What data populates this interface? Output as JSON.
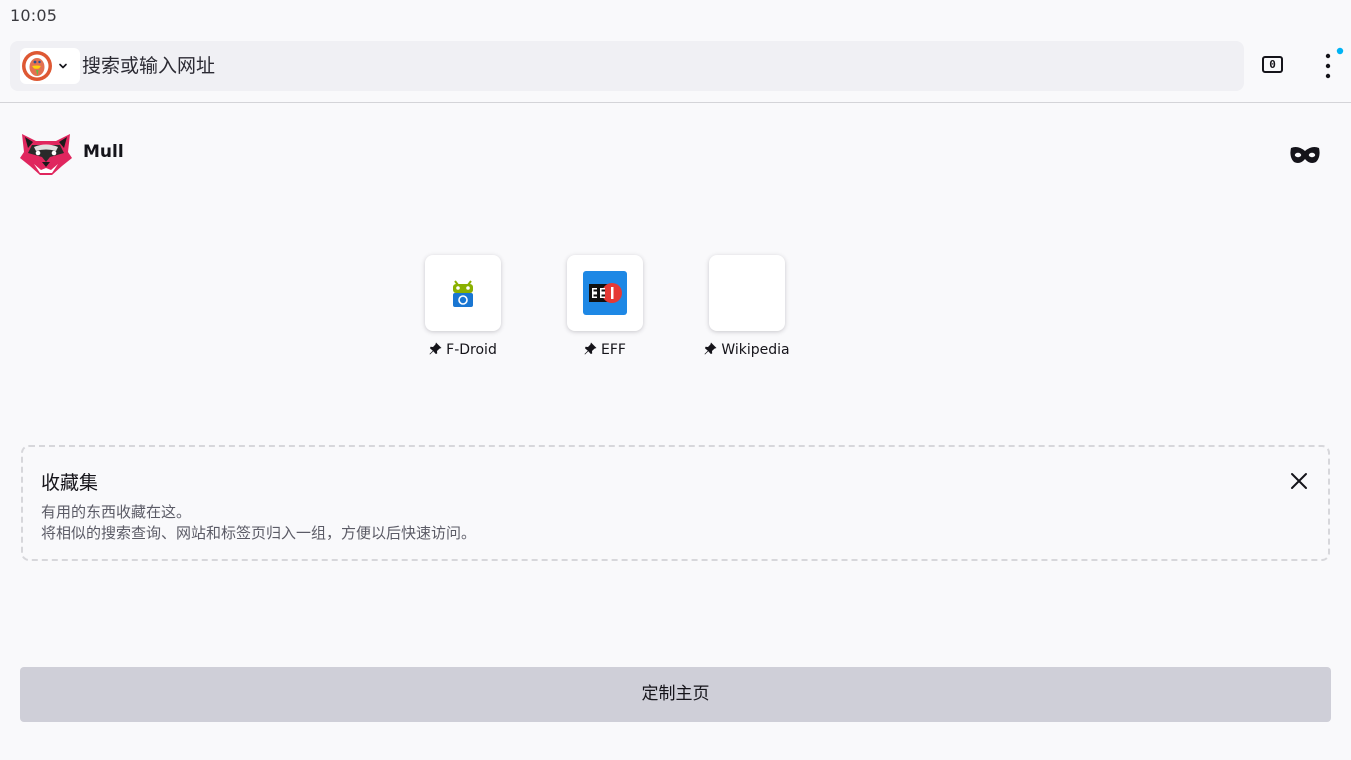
{
  "status_bar": {
    "time": "10:05"
  },
  "toolbar": {
    "search_engine_icon": "duckduckgo-icon",
    "url_placeholder": "搜索或输入网址",
    "tab_count": "0",
    "menu_icon": "three-dot-menu-icon",
    "notification_dot_color": "#00b3f4"
  },
  "header": {
    "brand_name": "Mull",
    "logo_icon": "red-panda-logo-icon",
    "private_mode_icon": "mask-icon",
    "brand_color": "#e0265e"
  },
  "shortcuts": [
    {
      "label": "F-Droid",
      "icon": "f-droid-icon",
      "pinned": true
    },
    {
      "label": "EFF",
      "icon": "eff-icon",
      "pinned": true
    },
    {
      "label": "Wikipedia",
      "icon": "wikipedia-icon",
      "pinned": true
    }
  ],
  "collections": {
    "title": "收藏集",
    "description_line1": "有用的东西收藏在这。",
    "description_line2": "将相似的搜索查询、网站和标签页归入一组，方便以后快速访问。",
    "close_icon": "close-icon"
  },
  "customize_button": {
    "label": "定制主页"
  },
  "colors": {
    "background": "#f9f9fb",
    "url_bar": "#f0f0f4",
    "button": "#cfcfd8"
  }
}
